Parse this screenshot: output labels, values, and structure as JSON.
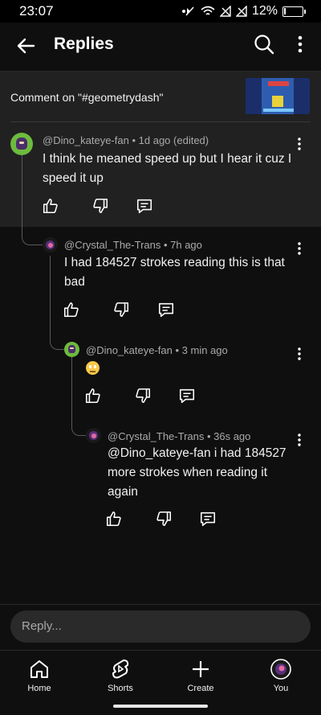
{
  "status": {
    "time": "23:07",
    "battery": "12%",
    "battery_level": 0.12
  },
  "appbar": {
    "title": "Replies"
  },
  "comment_on": {
    "text": "Comment on \"#geometrydash\""
  },
  "comments": [
    {
      "author": "@Dino_kateye-fan",
      "meta": " • 1d ago (edited)",
      "text": "I think he meaned speed up but I hear it cuz I speed it up"
    },
    {
      "author": "@Crystal_The-Trans",
      "meta": " • 7h ago",
      "text": "I had 184527 strokes reading this is that bad"
    },
    {
      "author": "@Dino_kateye-fan",
      "meta": " • 3 min ago",
      "text": "🙄"
    },
    {
      "author": "@Crystal_The-Trans",
      "meta": " • 36s ago",
      "text": "@Dino_kateye-fan i had 184527 more strokes when reading it again"
    }
  ],
  "reply": {
    "placeholder": "Reply..."
  },
  "nav": [
    {
      "label": "Home"
    },
    {
      "label": "Shorts"
    },
    {
      "label": "Create"
    },
    {
      "label": "You"
    }
  ]
}
